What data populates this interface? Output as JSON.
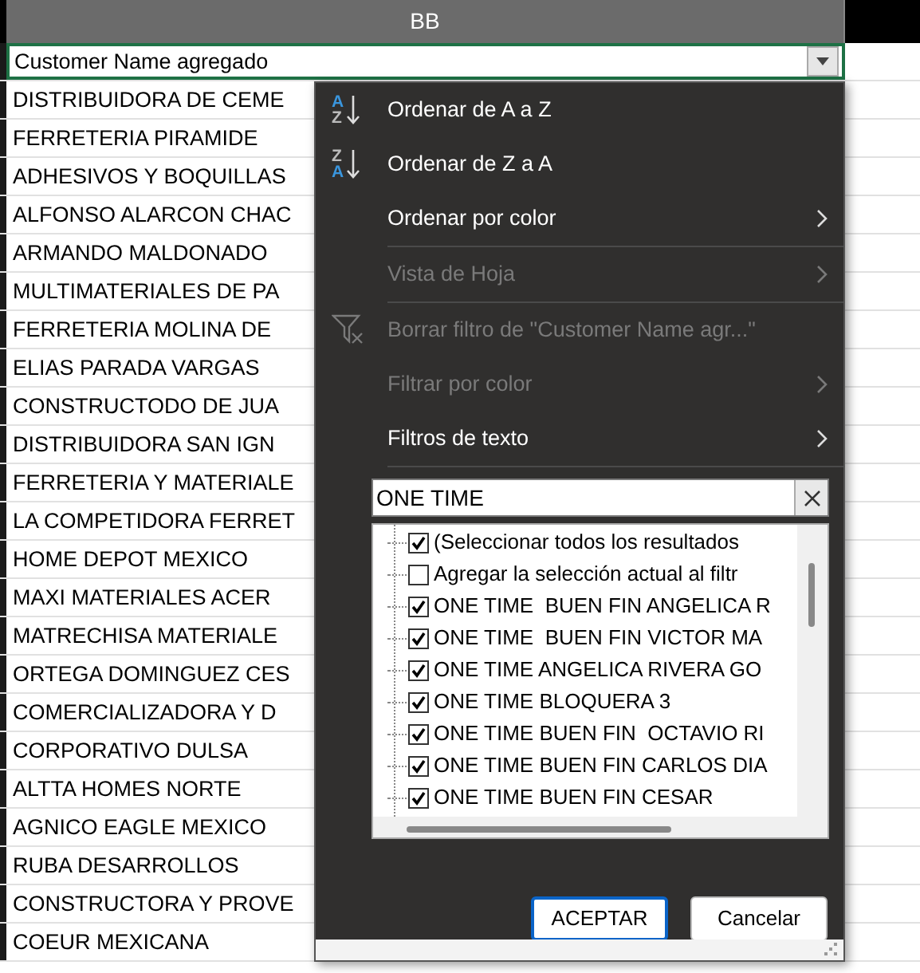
{
  "sheet": {
    "column_header": "BB",
    "header_cell": "Customer Name agregado",
    "rows": [
      "DISTRIBUIDORA DE CEME",
      "FERRETERIA PIRAMIDE",
      "ADHESIVOS Y BOQUILLAS",
      "ALFONSO ALARCON CHAC",
      "ARMANDO MALDONADO",
      "MULTIMATERIALES DE PA",
      "FERRETERIA MOLINA DE",
      "ELIAS PARADA VARGAS",
      "CONSTRUCTODO DE JUA",
      "DISTRIBUIDORA SAN IGN",
      "FERRETERIA Y MATERIALE",
      "LA COMPETIDORA FERRET",
      "HOME DEPOT MEXICO",
      "MAXI MATERIALES ACER",
      "MATRECHISA MATERIALE",
      "ORTEGA DOMINGUEZ CES",
      "COMERCIALIZADORA Y D",
      "CORPORATIVO DULSA",
      "ALTTA HOMES NORTE",
      "AGNICO EAGLE MEXICO",
      "RUBA DESARROLLOS",
      "CONSTRUCTORA Y PROVE",
      "COEUR MEXICANA"
    ]
  },
  "filter_menu": {
    "items": [
      {
        "kind": "sort_asc",
        "icon_top": "A",
        "icon_bottom": "Z",
        "label": "Ordenar de A a Z",
        "disabled": false
      },
      {
        "kind": "sort_desc",
        "icon_top": "Z",
        "icon_bottom": "A",
        "label": "Ordenar de Z a A",
        "disabled": false
      },
      {
        "kind": "submenu",
        "label": "Ordenar por color",
        "disabled": false
      },
      {
        "kind": "separator"
      },
      {
        "kind": "submenu",
        "label": "Vista de Hoja",
        "disabled": true
      },
      {
        "kind": "separator"
      },
      {
        "kind": "clear",
        "label": "Borrar filtro de \"Customer Name agr...\"",
        "disabled": true
      },
      {
        "kind": "submenu",
        "label": "Filtrar por color",
        "disabled": true
      },
      {
        "kind": "submenu",
        "label": "Filtros de texto",
        "disabled": false
      },
      {
        "kind": "separator"
      }
    ],
    "search": {
      "value": "ONE TIME"
    },
    "list": [
      {
        "label": "(Seleccionar todos los resultados",
        "checked": true
      },
      {
        "label": "Agregar la selección actual al filtr",
        "checked": false
      },
      {
        "label": "ONE TIME  BUEN FIN ANGELICA R",
        "checked": true
      },
      {
        "label": "ONE TIME  BUEN FIN VICTOR MA",
        "checked": true
      },
      {
        "label": "ONE TIME ANGELICA RIVERA GO",
        "checked": true
      },
      {
        "label": "ONE TIME BLOQUERA 3",
        "checked": true
      },
      {
        "label": "ONE TIME BUEN FIN  OCTAVIO RI",
        "checked": true
      },
      {
        "label": "ONE TIME BUEN FIN CARLOS DIA",
        "checked": true
      },
      {
        "label": "ONE TIME BUEN FIN CESAR",
        "checked": true
      }
    ],
    "buttons": [
      {
        "label": "ACEPTAR",
        "default": true
      },
      {
        "label": "Cancelar",
        "default": false
      }
    ]
  }
}
